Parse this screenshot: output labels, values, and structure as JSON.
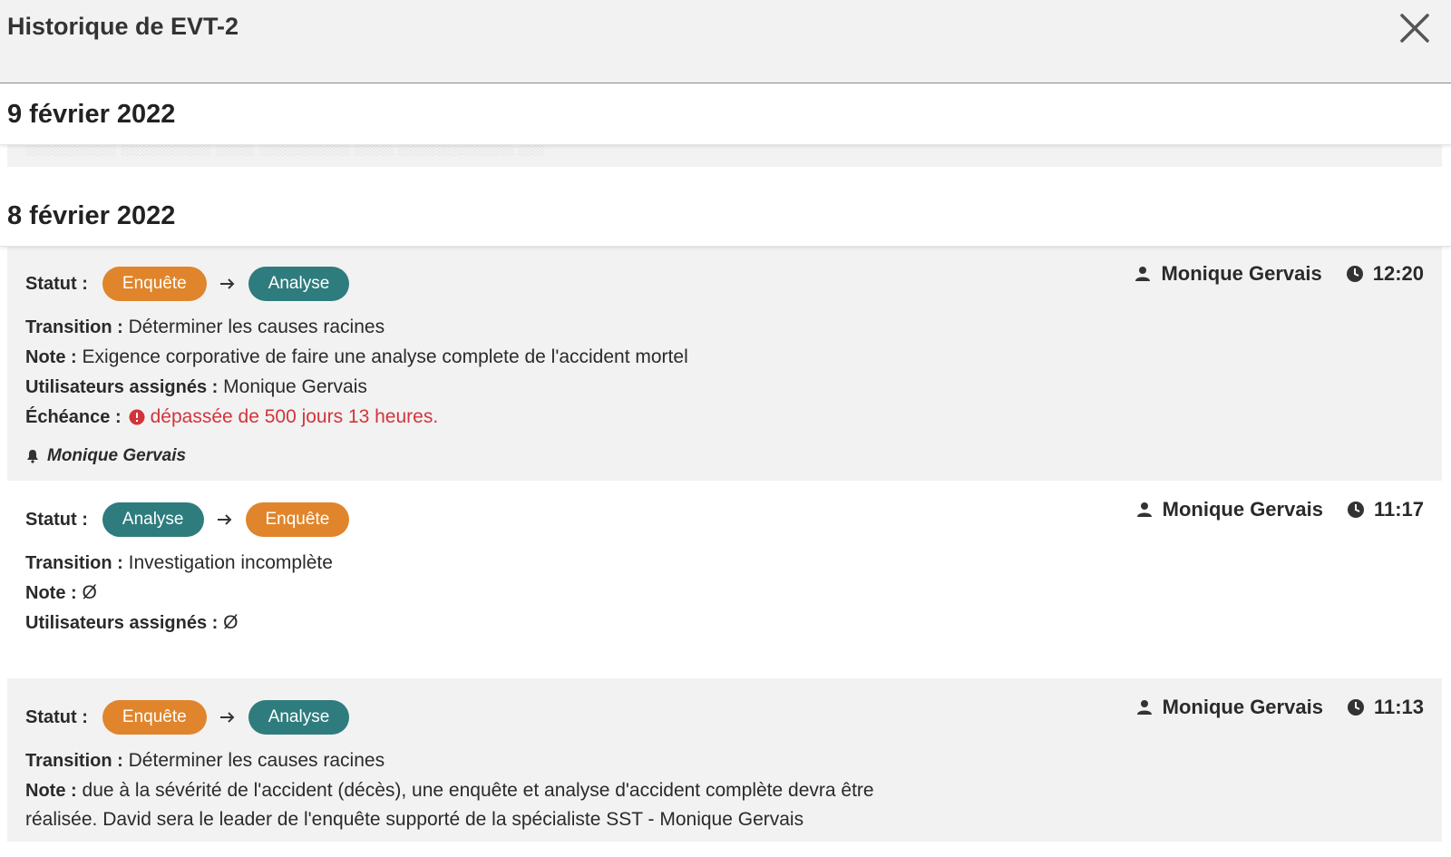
{
  "modal": {
    "title": "Historique de EVT-2"
  },
  "groups": [
    {
      "date": "9 février 2022"
    },
    {
      "date": "8 février 2022"
    }
  ],
  "entries": [
    {
      "status_label": "Statut :",
      "from_status": "Enquête",
      "to_status": "Analyse",
      "user": "Monique Gervais",
      "time": "12:20",
      "transition_label": "Transition :",
      "transition": "Déterminer les causes racines",
      "note_label": "Note :",
      "note": "Exigence corporative de faire une analyse complete de l'accident mortel",
      "assigned_label": "Utilisateurs assignés :",
      "assigned": "Monique Gervais",
      "deadline_label": "Échéance :",
      "deadline": "dépassée de 500 jours 13 heures.",
      "notified": "Monique Gervais"
    },
    {
      "status_label": "Statut :",
      "from_status": "Analyse",
      "to_status": "Enquête",
      "user": "Monique Gervais",
      "time": "11:17",
      "transition_label": "Transition :",
      "transition": "Investigation incomplète",
      "note_label": "Note :",
      "note": "Ø",
      "assigned_label": "Utilisateurs assignés :",
      "assigned": "Ø"
    },
    {
      "status_label": "Statut :",
      "from_status": "Enquête",
      "to_status": "Analyse",
      "user": "Monique Gervais",
      "time": "11:13",
      "transition_label": "Transition :",
      "transition": "Déterminer les causes racines",
      "note_label": "Note :",
      "note": "due à la sévérité de l'accident (décès), une enquête et analyse d'accident complète devra être",
      "note_cont": "réalisée. David sera le leader de l'enquête supporté de la spécialiste SST - Monique Gervais"
    }
  ],
  "colors": {
    "enquete": "#e0852c",
    "analyse": "#2f7c7e",
    "overdue": "#d2343b"
  }
}
